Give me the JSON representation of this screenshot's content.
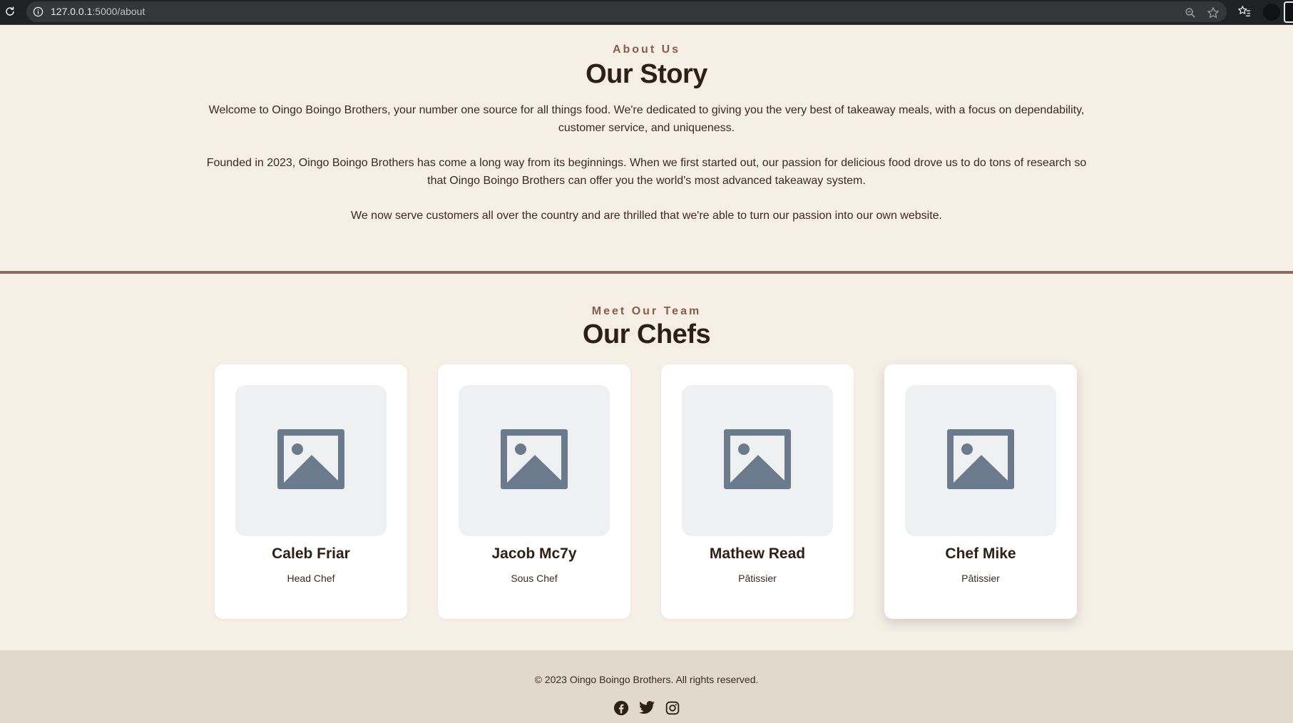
{
  "browser": {
    "url_host": "127.0.0.1",
    "url_rest": ":5000/about"
  },
  "about": {
    "eyebrow": "About Us",
    "title": "Our Story",
    "paragraphs": [
      "Welcome to Oingo Boingo Brothers, your number one source for all things food. We're dedicated to giving you the very best of takeaway meals, with a focus on dependability, customer service, and uniqueness.",
      "Founded in 2023, Oingo Boingo Brothers has come a long way from its beginnings. When we first started out, our passion for delicious food drove us to do tons of research so that Oingo Boingo Brothers can offer you the world's most advanced takeaway system.",
      "We now serve customers all over the country and are thrilled that we're able to turn our passion into our own website."
    ]
  },
  "team": {
    "eyebrow": "Meet Our Team",
    "title": "Our Chefs",
    "chefs": [
      {
        "name": "Caleb Friar",
        "role": "Head Chef",
        "photo_icon": "image-placeholder-icon"
      },
      {
        "name": "Jacob Mc7y",
        "role": "Sous Chef",
        "photo_icon": "image-placeholder-icon"
      },
      {
        "name": "Mathew Read",
        "role": "Pâtissier",
        "photo_icon": "image-placeholder-icon"
      },
      {
        "name": "Chef Mike",
        "role": "Pâtissier",
        "photo_icon": "image-placeholder-icon"
      }
    ]
  },
  "footer": {
    "copyright": "© 2023 Oingo Boingo Brothers. All rights reserved.",
    "social": [
      "facebook-icon",
      "twitter-icon",
      "instagram-icon"
    ]
  },
  "colors": {
    "page_bg": "#f5efe6",
    "accent": "#8a5a4a",
    "divider": "#8a6b60",
    "heading": "#2f2016",
    "footer_bg": "#e2d9cd",
    "placeholder_icon": "#6b7a8c"
  }
}
